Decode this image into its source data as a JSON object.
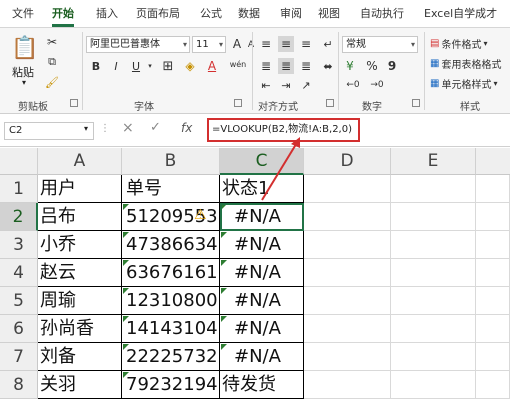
{
  "tabs": [
    "文件",
    "开始",
    "插入",
    "页面布局",
    "公式",
    "数据",
    "审阅",
    "视图",
    "自动执行",
    "Excel自学成才"
  ],
  "ribbon": {
    "clipboard": {
      "paste_label": "粘贴",
      "group": "剪贴板"
    },
    "font": {
      "name": "阿里巴巴普惠体",
      "size": "11",
      "grow": "A",
      "shrink": "A",
      "group": "字体",
      "phonetic": "wén"
    },
    "alignment": {
      "group": "对齐方式"
    },
    "number": {
      "format": "常规",
      "percent": "%",
      "comma": "9",
      "group": "数字"
    },
    "styles": {
      "conditional": "条件格式",
      "table": "套用表格格式",
      "cell": "单元格样式",
      "group": "样式"
    }
  },
  "formula_bar": {
    "name_box": "C2",
    "cancel": "×",
    "confirm": "✓",
    "fx": "fx",
    "formula": "=VLOOKUP(B2,物流!A:B,2,0)"
  },
  "columns": [
    "A",
    "B",
    "C",
    "D",
    "E"
  ],
  "rows": [
    "1",
    "2",
    "3",
    "4",
    "5",
    "6",
    "7",
    "8"
  ],
  "table": [
    [
      "用户",
      "单号",
      "状态1"
    ],
    [
      "吕布",
      "51209553",
      "#N/A"
    ],
    [
      "小乔",
      "47386634",
      "#N/A"
    ],
    [
      "赵云",
      "63676161",
      "#N/A"
    ],
    [
      "周瑜",
      "12310800",
      "#N/A"
    ],
    [
      "孙尚香",
      "14143104",
      "#N/A"
    ],
    [
      "刘备",
      "22225732",
      "#N/A"
    ],
    [
      "关羽",
      "79232194",
      "待发货"
    ]
  ],
  "colors": {
    "accent": "#217346",
    "highlight": "#d32f2f"
  }
}
